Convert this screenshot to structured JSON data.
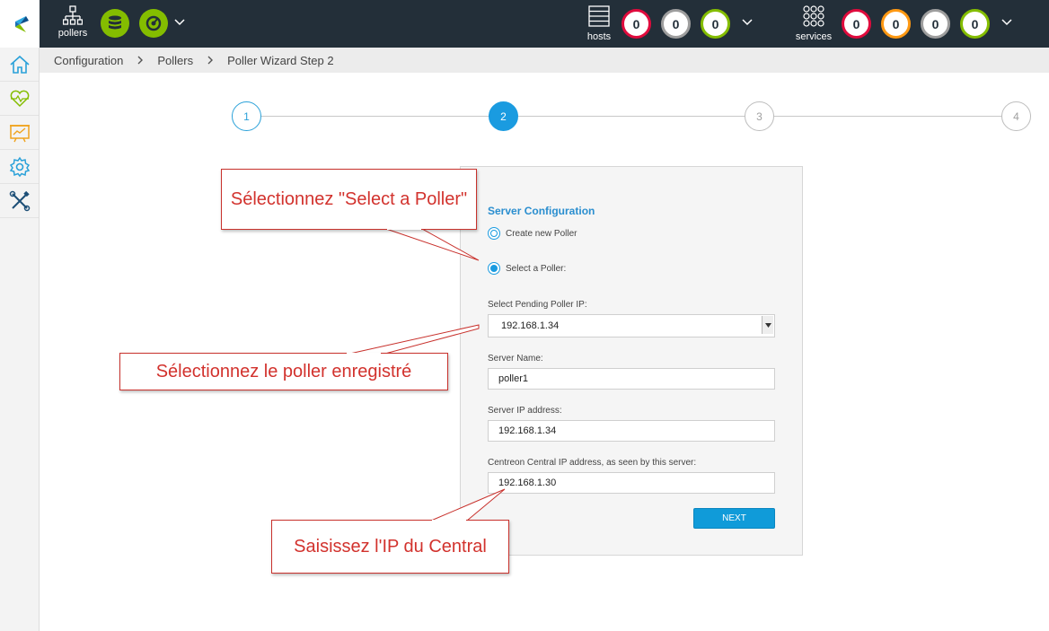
{
  "header": {
    "pollers_label": "pollers",
    "hosts_label": "hosts",
    "services_label": "services",
    "host_counters": [
      {
        "value": "0",
        "color": "#e00b3d"
      },
      {
        "value": "0",
        "color": "#9e9e9e"
      },
      {
        "value": "0",
        "color": "#84bd00"
      }
    ],
    "service_counters": [
      {
        "value": "0",
        "color": "#e00b3d"
      },
      {
        "value": "0",
        "color": "#ff9913"
      },
      {
        "value": "0",
        "color": "#9e9e9e"
      },
      {
        "value": "0",
        "color": "#84bd00"
      }
    ],
    "icons": [
      "pollers-icon",
      "database-icon",
      "latency-icon",
      "hosts-icon",
      "services-icon",
      "chevron-down-icon"
    ]
  },
  "sidebar": {
    "items": [
      "home-icon",
      "monitoring-icon",
      "reporting-icon",
      "configuration-icon",
      "administration-icon"
    ]
  },
  "breadcrumb": [
    "Configuration",
    "Pollers",
    "Poller Wizard Step 2"
  ],
  "stepper": {
    "steps": [
      "1",
      "2",
      "3",
      "4"
    ],
    "active": "2"
  },
  "form": {
    "title": "Server Configuration",
    "radio_create": "Create new Poller",
    "radio_select": "Select a Poller:",
    "selected_option": "Select a Poller:",
    "pending_label": "Select Pending Poller IP:",
    "pending_value": "192.168.1.34",
    "server_name_label": "Server Name:",
    "server_name_value": "poller1",
    "server_ip_label": "Server IP address:",
    "server_ip_value": "192.168.1.34",
    "central_ip_label": "Centreon Central IP address, as seen by this server:",
    "central_ip_value": "192.168.1.30",
    "next_button": "NEXT"
  },
  "annotations": {
    "select_poller": "Sélectionnez \"Select a Poller\"",
    "select_registered": "Sélectionnez le poller enregistré",
    "enter_central_ip": "Saisissez l'IP du Central"
  },
  "colors": {
    "topbar": "#232f39",
    "accent": "#1a9be0",
    "annotation": "#d2322d"
  }
}
